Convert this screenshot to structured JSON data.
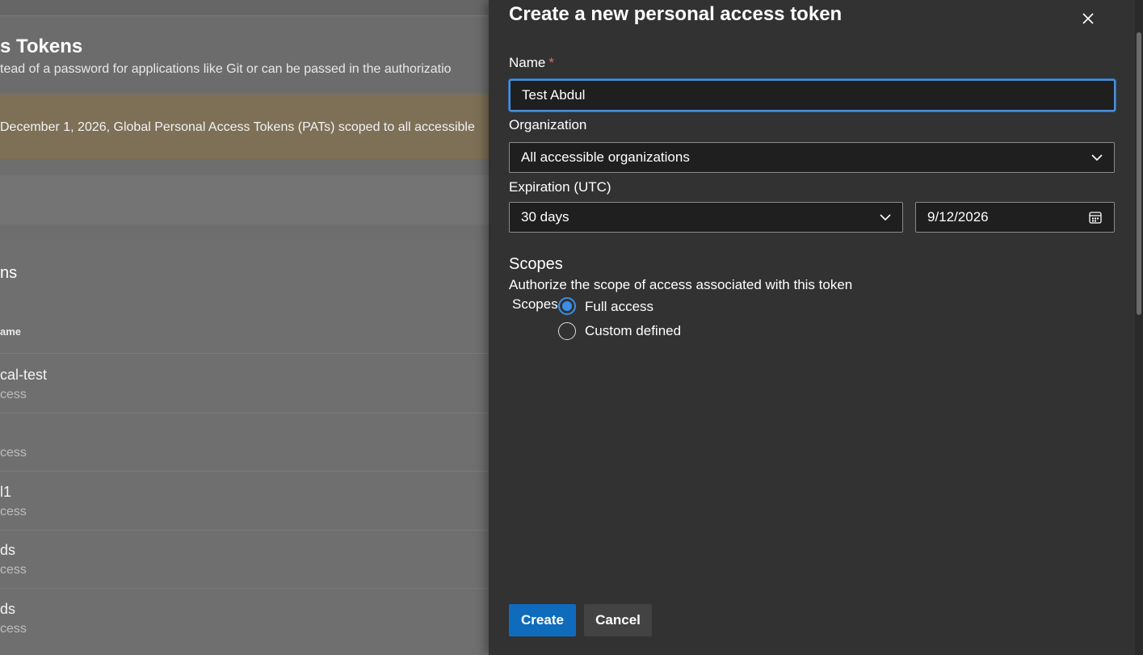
{
  "background": {
    "title": "s Tokens",
    "description": "tead of a password for applications like Git or can be passed in the authorizatio",
    "banner_text": "December 1, 2026, Global Personal Access Tokens (PATs) scoped to all accessible",
    "list_title": "ns",
    "column_header": "ame",
    "rows": [
      {
        "name": "cal-test",
        "sub": "cess"
      },
      {
        "name": "",
        "sub": "cess"
      },
      {
        "name": "l1",
        "sub": "cess"
      },
      {
        "name": "ds",
        "sub": "cess"
      },
      {
        "name": "ds",
        "sub": "cess"
      }
    ]
  },
  "panel": {
    "title": "Create a new personal access token",
    "name_label": "Name",
    "required_mark": "*",
    "name_value": "Test Abdul",
    "organization_label": "Organization",
    "organization_value": "All accessible organizations",
    "expiration_label": "Expiration (UTC)",
    "expiration_value": "30 days",
    "expiration_date": "9/12/2026",
    "scopes_heading": "Scopes",
    "scopes_description": "Authorize the scope of access associated with this token",
    "scopes_label": "Scopes",
    "scope_options": [
      {
        "label": "Full access",
        "checked": true
      },
      {
        "label": "Custom defined",
        "checked": false
      }
    ],
    "create_label": "Create",
    "cancel_label": "Cancel"
  },
  "colors": {
    "accent": "#0f6cbd",
    "panel_bg": "#323232",
    "input_focus": "#4a90d9",
    "banner": "#7d7057"
  },
  "icons": {
    "close": "close-icon",
    "dropdown": "chevron-down-icon",
    "calendar": "calendar-icon"
  }
}
